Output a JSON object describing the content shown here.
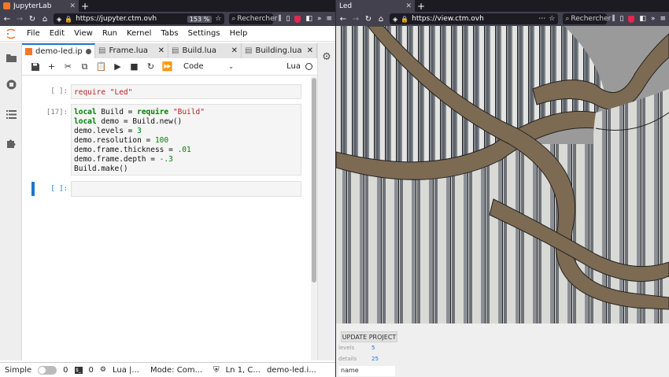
{
  "left_browser": {
    "tab_title": "JupyterLab",
    "url": "https://jupyter.ctm.ovh",
    "zoom": "153 %",
    "search_placeholder": "Rechercher"
  },
  "right_browser": {
    "tab_title": "Led",
    "url": "https://view.ctm.ovh",
    "search_placeholder": "Rechercher"
  },
  "jupyter": {
    "menu": [
      "File",
      "Edit",
      "View",
      "Run",
      "Kernel",
      "Tabs",
      "Settings",
      "Help"
    ],
    "tabs": [
      "demo-led.ipyn",
      "Frame.lua",
      "Build.lua",
      "Building.lua"
    ],
    "cell_type": "Code",
    "kernel": "Lua",
    "cells": [
      {
        "prompt": "[ ]:",
        "code": "require \"Led\""
      },
      {
        "prompt": "[17]:",
        "code": "local Build = require \"Build\"\nlocal demo = Build.new()\ndemo.levels = 3\ndemo.resolution = 100\ndemo.frame.thickness = .01\ndemo.frame.depth = -.3\nBuild.make()"
      },
      {
        "prompt": "[ ]:",
        "code": ""
      }
    ],
    "status": {
      "mode_label": "Simple",
      "count_a": "0",
      "count_b": "0",
      "kernel": "Lua |...",
      "mode": "Mode: Com...",
      "position": "Ln 1, C...",
      "file": "demo-led.i..."
    }
  },
  "viewer": {
    "update_button": "UPDATE PROJECT",
    "params": [
      {
        "label": "levels",
        "value": "5"
      },
      {
        "label": "details",
        "value": "25"
      }
    ],
    "name_field": "name"
  }
}
